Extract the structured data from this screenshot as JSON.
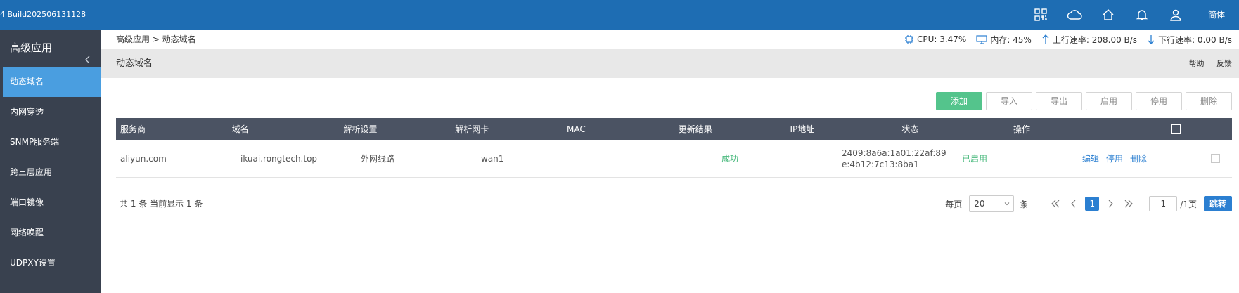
{
  "header": {
    "build": "4 Build202506131128",
    "lang": "简体",
    "icons": [
      "grid-icon",
      "cloud-icon",
      "home-icon",
      "bell-icon",
      "user-icon"
    ]
  },
  "sidebar": {
    "title": "高级应用",
    "items": [
      {
        "label": "动态域名",
        "active": true
      },
      {
        "label": "内网穿透"
      },
      {
        "label": "SNMP服务端"
      },
      {
        "label": "跨三层应用"
      },
      {
        "label": "端口镜像"
      },
      {
        "label": "网络唤醒"
      },
      {
        "label": "UDPXY设置"
      }
    ]
  },
  "breadcrumb": "高级应用 > 动态域名",
  "stats": {
    "cpu": "CPU: 3.47%",
    "mem": "内存: 45%",
    "up": "上行速率: 208.00 B/s",
    "down": "下行速率: 0.00 B/s"
  },
  "page": {
    "title": "动态域名",
    "help": "帮助",
    "feedback": "反馈"
  },
  "toolbar": {
    "add": "添加",
    "import": "导入",
    "export": "导出",
    "enable": "启用",
    "disable": "停用",
    "delete": "删除"
  },
  "table": {
    "headers": [
      "服务商",
      "域名",
      "解析设置",
      "解析网卡",
      "MAC",
      "更新结果",
      "IP地址",
      "状态",
      "操作"
    ],
    "rows": [
      {
        "provider": "aliyun.com",
        "domain": "ikuai.rongtech.top",
        "resolve": "外网线路",
        "nic": "wan1",
        "mac": "",
        "result": "成功",
        "ip": "2409:8a6a:1a01:22af:89e:4b12:7c13:8ba1",
        "status": "已启用",
        "ops": {
          "edit": "编辑",
          "disable": "停用",
          "delete": "删除"
        }
      }
    ]
  },
  "footer": {
    "summary": "共 1 条 当前显示 1 条",
    "per_page_label": "每页",
    "per_page_value": "20",
    "per_page_unit": "条",
    "current_page": "1",
    "page_input": "1",
    "total_pages": "/1页",
    "jump": "跳转"
  },
  "colors": {
    "topbar": "#1e6db3",
    "sidebar": "#39414f",
    "active": "#4a9ee0",
    "primary": "#54c48c",
    "link": "#2b7fd1"
  }
}
